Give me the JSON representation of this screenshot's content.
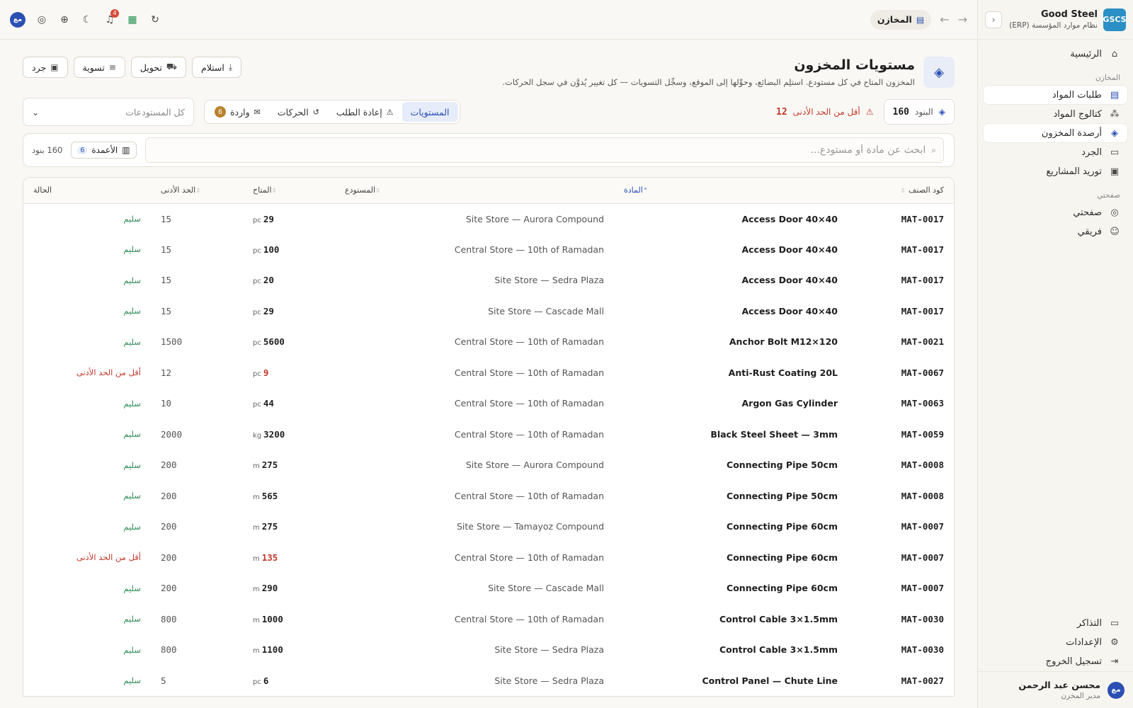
{
  "brand": {
    "logo": "GSCS",
    "name": "Good Steel",
    "subtitle": "نظام موارد المؤسسة (ERP)"
  },
  "sidebar": {
    "home": "الرئيسية",
    "section_inventory": "المخازن",
    "items": [
      {
        "label": "طلبات المواد",
        "icon": "bank-icon"
      },
      {
        "label": "كتالوج المواد",
        "icon": "boxes-icon"
      },
      {
        "label": "أرصدة المخزون",
        "icon": "cube-icon"
      },
      {
        "label": "الجرد",
        "icon": "clipboard-icon"
      },
      {
        "label": "توريد المشاريع",
        "icon": "truck-icon"
      }
    ],
    "section_mypage": "صفحتي",
    "my_items": [
      {
        "label": "صفحتي"
      },
      {
        "label": "فريقي"
      }
    ],
    "bottom": [
      {
        "label": "التذاكر"
      },
      {
        "label": "الإعدادات"
      },
      {
        "label": "تسجيل الخروج"
      }
    ],
    "user": {
      "initials": "مع",
      "name": "محسن عبد الرحمن",
      "role": "مدير المخزن"
    }
  },
  "topbar": {
    "breadcrumb": "المخازن",
    "notifications": "4",
    "avatar": "مع"
  },
  "header": {
    "title": "مستويات المخزون",
    "description": "المخزون المتاح في كل مستودع. استلِم البضائع، وحوِّلها إلى الموقع، وسجِّل التسويات — كل تغيير يُدوَّن في سجل الحركات.",
    "actions": {
      "receive": "استلام",
      "transfer": "تحويل",
      "adjust": "تسوية",
      "count": "جرد"
    }
  },
  "stats": {
    "items_label": "البنود",
    "items_value": "160",
    "below_min_label": "أقل من الحد الأدنى",
    "below_min_value": "12"
  },
  "tabs": [
    {
      "label": "المستويات",
      "active": true
    },
    {
      "label": "إعادة الطلب"
    },
    {
      "label": "الحركات"
    },
    {
      "label": "واردة",
      "count": "6"
    }
  ],
  "warehouse_filter": {
    "value": "كل المستودعات"
  },
  "search": {
    "placeholder": "ابحث عن مادة أو مستودع..."
  },
  "columns_button": {
    "label": "الأعمدة",
    "count": "6"
  },
  "rows_count": "160 بنود",
  "table": {
    "headers": {
      "code": "كود الصنف",
      "item": "المادة",
      "warehouse": "المستودع",
      "available": "المتاح",
      "min": "الحد الأدنى",
      "status": "الحالة"
    },
    "status_labels": {
      "ok": "سليم",
      "low": "أقل من الحد الأدنى"
    },
    "rows": [
      {
        "code": "MAT-0017",
        "item": "Access Door 40×40",
        "warehouse": "Site Store — Aurora Compound",
        "qty": "29",
        "unit": "pc",
        "min": "15",
        "status": "ok"
      },
      {
        "code": "MAT-0017",
        "item": "Access Door 40×40",
        "warehouse": "Central Store — 10th of Ramadan",
        "qty": "100",
        "unit": "pc",
        "min": "15",
        "status": "ok"
      },
      {
        "code": "MAT-0017",
        "item": "Access Door 40×40",
        "warehouse": "Site Store — Sedra Plaza",
        "qty": "20",
        "unit": "pc",
        "min": "15",
        "status": "ok"
      },
      {
        "code": "MAT-0017",
        "item": "Access Door 40×40",
        "warehouse": "Site Store — Cascade Mall",
        "qty": "29",
        "unit": "pc",
        "min": "15",
        "status": "ok"
      },
      {
        "code": "MAT-0021",
        "item": "Anchor Bolt M12×120",
        "warehouse": "Central Store — 10th of Ramadan",
        "qty": "5600",
        "unit": "pc",
        "min": "1500",
        "status": "ok"
      },
      {
        "code": "MAT-0067",
        "item": "Anti-Rust Coating 20L",
        "warehouse": "Central Store — 10th of Ramadan",
        "qty": "9",
        "unit": "pc",
        "min": "12",
        "status": "low"
      },
      {
        "code": "MAT-0063",
        "item": "Argon Gas Cylinder",
        "warehouse": "Central Store — 10th of Ramadan",
        "qty": "44",
        "unit": "pc",
        "min": "10",
        "status": "ok"
      },
      {
        "code": "MAT-0059",
        "item": "Black Steel Sheet — 3mm",
        "warehouse": "Central Store — 10th of Ramadan",
        "qty": "3200",
        "unit": "kg",
        "min": "2000",
        "status": "ok"
      },
      {
        "code": "MAT-0008",
        "item": "Connecting Pipe 50cm",
        "warehouse": "Site Store — Aurora Compound",
        "qty": "275",
        "unit": "m",
        "min": "200",
        "status": "ok"
      },
      {
        "code": "MAT-0008",
        "item": "Connecting Pipe 50cm",
        "warehouse": "Central Store — 10th of Ramadan",
        "qty": "565",
        "unit": "m",
        "min": "200",
        "status": "ok"
      },
      {
        "code": "MAT-0007",
        "item": "Connecting Pipe 60cm",
        "warehouse": "Site Store — Tamayoz Compound",
        "qty": "275",
        "unit": "m",
        "min": "200",
        "status": "ok"
      },
      {
        "code": "MAT-0007",
        "item": "Connecting Pipe 60cm",
        "warehouse": "Central Store — 10th of Ramadan",
        "qty": "135",
        "unit": "m",
        "min": "200",
        "status": "low"
      },
      {
        "code": "MAT-0007",
        "item": "Connecting Pipe 60cm",
        "warehouse": "Site Store — Cascade Mall",
        "qty": "290",
        "unit": "m",
        "min": "200",
        "status": "ok"
      },
      {
        "code": "MAT-0030",
        "item": "Control Cable 3×1.5mm",
        "warehouse": "Central Store — 10th of Ramadan",
        "qty": "1000",
        "unit": "m",
        "min": "800",
        "status": "ok"
      },
      {
        "code": "MAT-0030",
        "item": "Control Cable 3×1.5mm",
        "warehouse": "Site Store — Sedra Plaza",
        "qty": "1100",
        "unit": "m",
        "min": "800",
        "status": "ok"
      },
      {
        "code": "MAT-0027",
        "item": "Control Panel — Chute Line",
        "warehouse": "Site Store — Sedra Plaza",
        "qty": "6",
        "unit": "pc",
        "min": "5",
        "status": "ok"
      }
    ]
  }
}
